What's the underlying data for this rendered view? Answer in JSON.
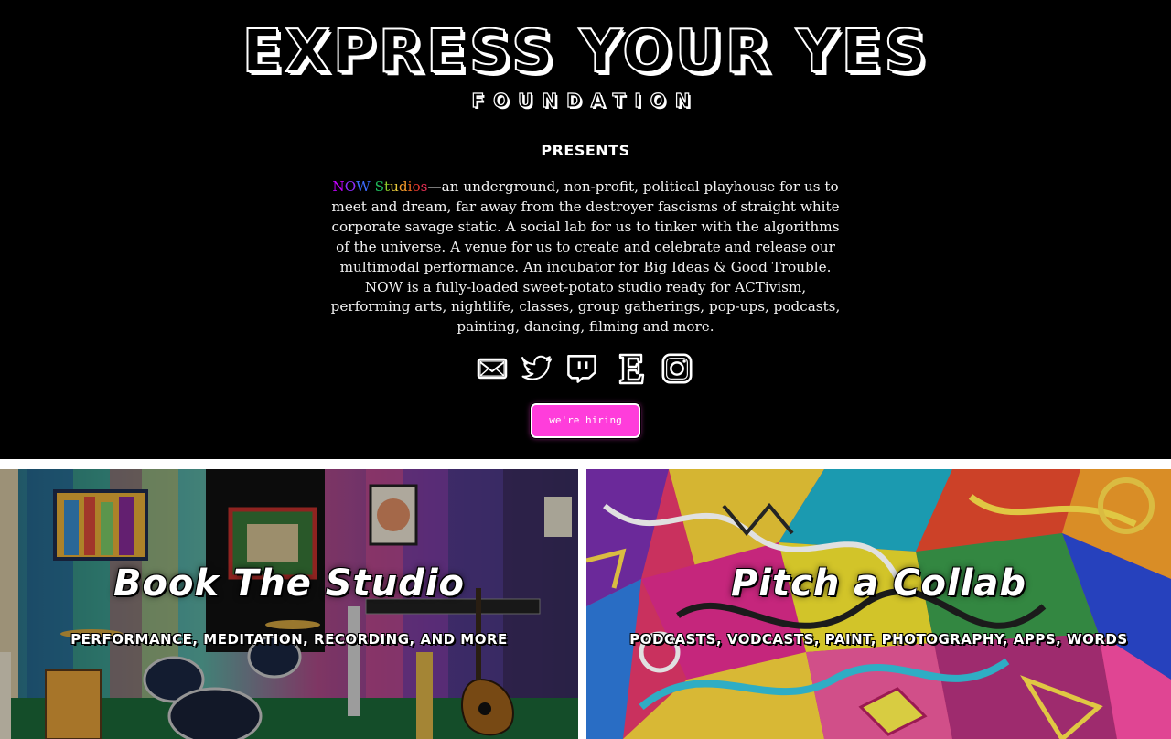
{
  "header": {
    "title": "EXPRESS YOUR YES",
    "subtitle": "FOUNDATION",
    "presents": "Presents"
  },
  "intro": {
    "brand_parts": [
      "N",
      "O",
      "W",
      " ",
      "S",
      "t",
      "u",
      "d",
      "i",
      "o",
      "s"
    ],
    "brand": "NOW Studios",
    "text": "—an underground, non-profit, political playhouse for us to meet and dream, far away from the destroyer fascisms of straight white corporate savage static. A social lab for us to tinker with the algorithms of the universe. A venue for us to create and celebrate and release our multimodal performance. An incubator for Big Ideas & Good Trouble. NOW is a fully-loaded sweet-potato studio ready for ACTivism, performing arts, nightlife, classes, group gatherings, pop-ups, podcasts, painting, dancing, filming and more."
  },
  "socials": [
    {
      "icon": "mail-icon"
    },
    {
      "icon": "twitter-icon"
    },
    {
      "icon": "twitch-icon"
    },
    {
      "icon": "etsy-icon"
    },
    {
      "icon": "instagram-icon"
    }
  ],
  "hiring_button": "we're hiring",
  "panels": [
    {
      "title": "Book The Studio",
      "subtitle": "Performance, meditation, recording, and more"
    },
    {
      "title": "Pitch a Collab",
      "subtitle": "Podcasts, vodcasts, paint, photography, apps, words"
    }
  ],
  "colors": {
    "background": "#000000",
    "button_pink": "#ff3ddb",
    "text": "#ffffff"
  }
}
